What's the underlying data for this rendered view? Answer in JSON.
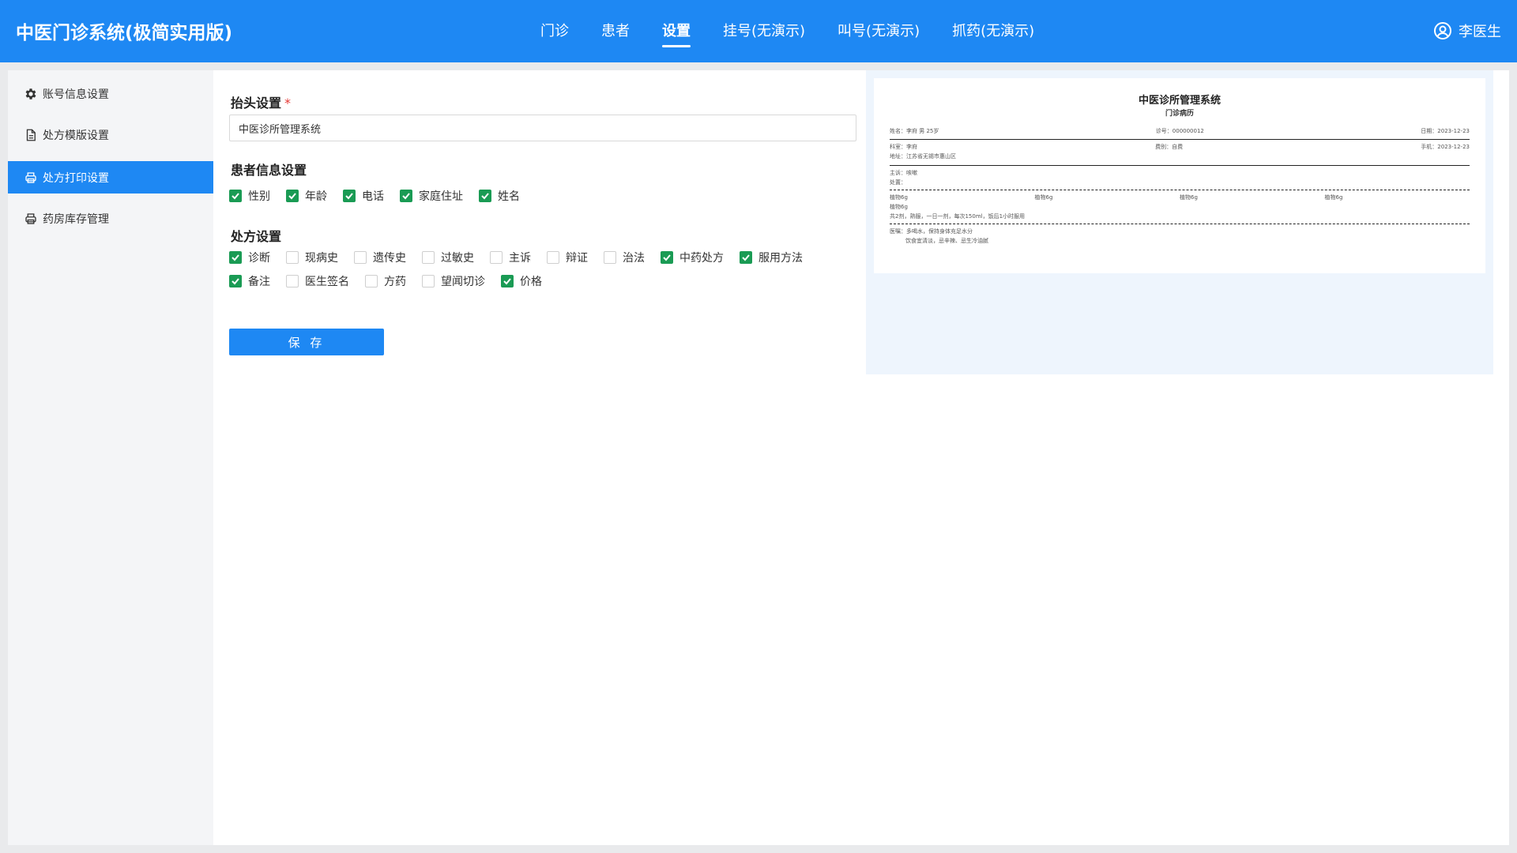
{
  "app": {
    "title": "中医门诊系统(极简实用版)"
  },
  "nav": {
    "items": [
      {
        "label": "门诊"
      },
      {
        "label": "患者"
      },
      {
        "label": "设置"
      },
      {
        "label": "挂号(无演示)"
      },
      {
        "label": "叫号(无演示)"
      },
      {
        "label": "抓药(无演示)"
      }
    ],
    "active": "设置"
  },
  "user": {
    "name": "李医生"
  },
  "sidebar": {
    "items": [
      {
        "label": "账号信息设置",
        "icon": "gear-icon"
      },
      {
        "label": "处方模版设置",
        "icon": "document-icon"
      },
      {
        "label": "处方打印设置",
        "icon": "printer-icon"
      },
      {
        "label": "药房库存管理",
        "icon": "printer-icon"
      }
    ],
    "active": "处方打印设置"
  },
  "form": {
    "header_section": {
      "title": "抬头设置",
      "required_mark": "*",
      "value": "中医诊所管理系统"
    },
    "patient_section": {
      "title": "患者信息设置",
      "options": [
        {
          "label": "性别",
          "checked": true
        },
        {
          "label": "年龄",
          "checked": true
        },
        {
          "label": "电话",
          "checked": true
        },
        {
          "label": "家庭住址",
          "checked": true
        },
        {
          "label": "姓名",
          "checked": true
        }
      ]
    },
    "prescription_section": {
      "title": "处方设置",
      "options_row1": [
        {
          "label": "诊断",
          "checked": true
        },
        {
          "label": "现病史",
          "checked": false
        },
        {
          "label": "遗传史",
          "checked": false
        },
        {
          "label": "过敏史",
          "checked": false
        },
        {
          "label": "主诉",
          "checked": false
        },
        {
          "label": "辩证",
          "checked": false
        },
        {
          "label": "治法",
          "checked": false
        },
        {
          "label": "中药处方",
          "checked": true
        },
        {
          "label": "服用方法",
          "checked": true
        }
      ],
      "options_row2": [
        {
          "label": "备注",
          "checked": true
        },
        {
          "label": "医生签名",
          "checked": false
        },
        {
          "label": "方药",
          "checked": false
        },
        {
          "label": "望闻切诊",
          "checked": false
        },
        {
          "label": "价格",
          "checked": true
        }
      ]
    },
    "save_label": "保 存"
  },
  "preview": {
    "title": "中医诊所管理系统",
    "subtitle": "门诊病历",
    "row1": {
      "left": "姓名：李府   男   25岁",
      "mid": "诊号：000000012",
      "right": "日期：2023-12-23"
    },
    "row2": {
      "left": "科室：李府",
      "mid": "费别：自费",
      "right": "手机：2023-12-23"
    },
    "address": "地址：江苏省无锡市惠山区",
    "complaint": "主诉：咳嗽",
    "treatment": "处置：",
    "herbs": [
      "植物6g",
      "植物6g",
      "植物6g",
      "植物6g"
    ],
    "herb_extra": "植物6g",
    "usage": "共2剂，熟服，一日一剂，每次150ml，饭后1小时服用",
    "advice_1": "医嘱：多喝水，保持身体充足水分",
    "advice_2": "饮食宜清淡，忌辛辣、忌生冷油腻"
  },
  "colors": {
    "primary": "#1e88f3",
    "check": "#1a9b54",
    "required": "#e53935"
  }
}
